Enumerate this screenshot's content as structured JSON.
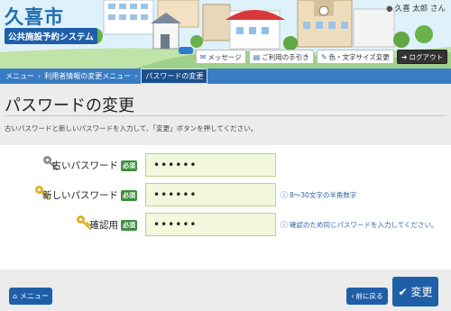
{
  "header": {
    "title": "久喜市",
    "subtitle": "公共施設予約システム",
    "user_icon": "user-icon",
    "user": "久喜 太郎 さん",
    "buttons": [
      {
        "icon": "message-icon",
        "label": "メッセージ"
      },
      {
        "icon": "book-icon",
        "label": "ご利用の手引き"
      },
      {
        "icon": "pencil-icon",
        "label": "色・文字サイズ変更"
      },
      {
        "icon": "logout-icon",
        "label": "ログアウト"
      }
    ]
  },
  "breadcrumb": {
    "items": [
      "メニュー",
      "利用者情報の変更メニュー",
      "パスワードの変更"
    ]
  },
  "page": {
    "title": "パスワードの変更",
    "instruction": "古いパスワードと新しいパスワードを入力して、「変更」ボタンを押してください。"
  },
  "form": {
    "required_label": "必須",
    "old_password": {
      "label": "古いパスワード",
      "value": "••••••"
    },
    "new_password": {
      "label": "新しいパスワード",
      "value": "••••••",
      "hint": "8～30文字の半角数字"
    },
    "confirm_password": {
      "label": "確認用",
      "value": "••••••",
      "hint": "確認のため同じパスワードを入力してください。"
    }
  },
  "footer": {
    "menu_label": "メニュー",
    "back_label": "前に戻る",
    "submit_label": "変更"
  },
  "colors": {
    "primary": "#1f5fa8",
    "required": "#3e8e3e",
    "input_bg": "#f1f8dc",
    "key_gray": "#8a8a8a",
    "key_gold": "#e0b020"
  }
}
